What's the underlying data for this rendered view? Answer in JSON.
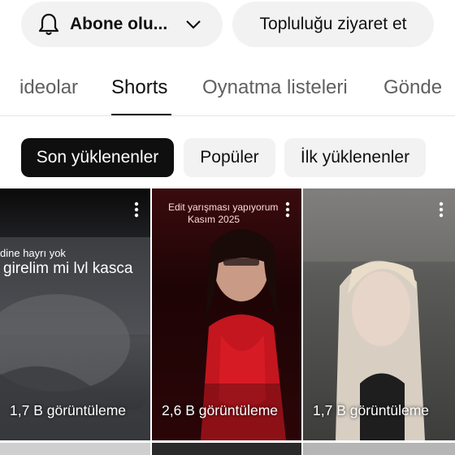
{
  "header": {
    "subscribe_label": "Abone olu...",
    "community_label": "Topluluğu ziyaret et"
  },
  "tabs": [
    {
      "label": "ideolar"
    },
    {
      "label": "Shorts",
      "active": true
    },
    {
      "label": "Oynatma listeleri"
    },
    {
      "label": "Gönde"
    }
  ],
  "chips": [
    {
      "label": "Son yüklenenler",
      "selected": true
    },
    {
      "label": "Popüler"
    },
    {
      "label": "İlk yüklenenler"
    }
  ],
  "shorts": [
    {
      "views": "1,7 B görüntüleme",
      "overlay": [
        "dine hayrı yok",
        "girelim mi lvl kasca"
      ]
    },
    {
      "views": "2,6 B görüntüleme",
      "overlay": [
        "Edit yarışması yapıyorum",
        "Kasım 2025"
      ]
    },
    {
      "views": "1,7 B görüntüleme",
      "overlay": []
    }
  ],
  "icons": {
    "bell": "bell-icon",
    "chevron": "chevron-down-icon",
    "more": "more-vert-icon"
  },
  "colors": {
    "chip_selected_bg": "#0f0f0f",
    "chip_bg": "#f2f2f2",
    "text_secondary": "#606060"
  }
}
